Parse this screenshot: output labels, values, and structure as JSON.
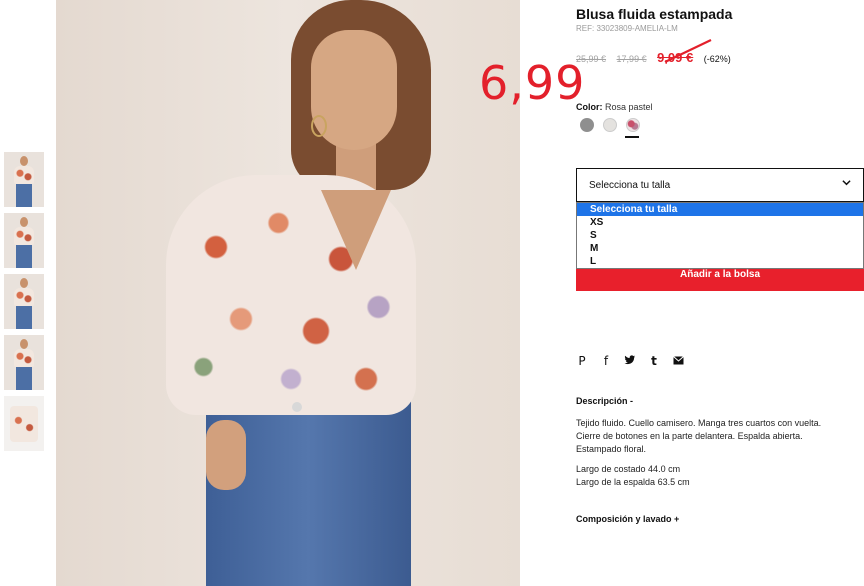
{
  "product": {
    "title": "Blusa fluida estampada",
    "ref": "REF: 33023809-AMELIA-LM",
    "prices": {
      "original": "25,99 €",
      "previous": "17,99 €",
      "current": "9,09 €",
      "discount": "(-62%)"
    },
    "annotated_price": "6,99"
  },
  "color": {
    "label": "Color:",
    "value": "Rosa pastel",
    "swatches": [
      "grey",
      "white",
      "pink-floral"
    ],
    "selected_index": 2
  },
  "size": {
    "placeholder": "Selecciona tu talla",
    "options": [
      "Selecciona tu talla",
      "XS",
      "S",
      "M",
      "L"
    ],
    "selected_index": 0
  },
  "actions": {
    "add_to_bag": "Añadir a la bolsa"
  },
  "share": {
    "icons": [
      "pinterest-icon",
      "facebook-icon",
      "twitter-icon",
      "tumblr-icon",
      "email-icon"
    ],
    "glyphs": [
      "P",
      "f",
      "t",
      "t",
      "✉"
    ]
  },
  "description": {
    "title": "Descripción -",
    "lines": [
      "Tejido fluido. Cuello camisero. Manga tres cuartos con vuelta.",
      "Cierre de botones en la parte delantera. Espalda abierta.",
      "Estampado floral."
    ],
    "measurements": [
      "Largo de costado 44.0 cm",
      "Largo de la espalda 63.5 cm"
    ]
  },
  "composition": {
    "title": "Composición y lavado +"
  },
  "colors": {
    "accent_red": "#e3202b",
    "select_blue": "#1e74e8"
  }
}
